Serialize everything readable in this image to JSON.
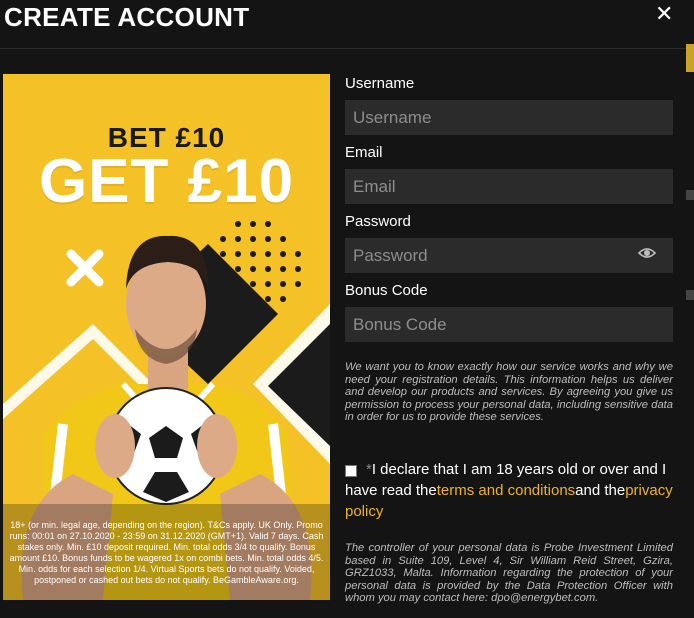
{
  "header": {
    "title": "CREATE ACCOUNT",
    "close_icon": "close-icon"
  },
  "banner": {
    "line1": "BET £10",
    "line2": "GET £10",
    "terms": "18+ (or min. legal age, depending on the region). T&Cs apply. UK Only. Promo runs: 00:01 on 27.10.2020 - 23:59 on 31.12.2020 (GMT+1). Valid 7 days. Cash stakes only. Min. £10 deposit required. Min. total odds 3/4 to qualify. Bonus amount £10. Bonus funds to be wagered 1x on combi bets. Min. total odds 4/5. Min. odds for each selection 1/4. Virtual Sports bets do not qualify. Voided, postponed or cashed out bets do not qualify. BeGambleAware.org.",
    "accent_color": "#f4c127"
  },
  "form": {
    "username_label": "Username",
    "username_placeholder": "Username",
    "email_label": "Email",
    "email_placeholder": "Email",
    "password_label": "Password",
    "password_placeholder": "Password",
    "password_toggle_icon": "eye-icon",
    "bonus_label": "Bonus Code",
    "bonus_placeholder": "Bonus Code",
    "info_text": "We want you to know exactly how our service works and why we need your registration details. This information helps us deliver and develop our products and services. By agreeing you give us permission to process your personal data, including sensitive data in order for us to provide these services.",
    "declare_star": "*",
    "declare_text_1": "I declare that I am 18 years old or over and I have read the",
    "terms_link": "terms and conditions",
    "declare_text_2": "and the",
    "privacy_link": "privacy policy",
    "controller_text": "The controller of your personal data is Probe Investment Limited based in Suite 109, Level 4, Sir William Reid Street, Gzira, GRZ1033, Malta. Information regarding the protection of your personal data is provided by the Data Protection Officer with whom you may contact here: dpo@energybet.com.",
    "link_color": "#f0b41c"
  }
}
